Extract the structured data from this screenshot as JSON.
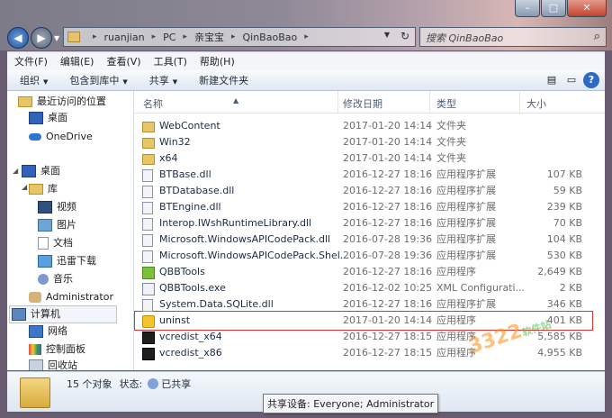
{
  "window": {
    "min": "–",
    "max": "□",
    "close": "✕"
  },
  "address": {
    "crumbs": [
      "ruanjian",
      "PC",
      "亲宝宝",
      "QinBaoBao"
    ]
  },
  "search": {
    "placeholder": "搜索 QinBaoBao"
  },
  "menu": [
    "文件(F)",
    "编辑(E)",
    "查看(V)",
    "工具(T)",
    "帮助(H)"
  ],
  "toolbar": {
    "organize": "组织",
    "include": "包含到库中",
    "share": "共享",
    "new_folder": "新建文件夹"
  },
  "sidebar": {
    "recent": "最近访问的位置",
    "desktop_fav": "桌面",
    "onedrive": "OneDrive",
    "desktop": "桌面",
    "libraries": "库",
    "videos": "视频",
    "pictures": "图片",
    "documents": "文档",
    "thunder": "迅雷下载",
    "music": "音乐",
    "admin": "Administrator",
    "computer": "计算机",
    "network": "网络",
    "control": "控制面板",
    "recycle": "回收站"
  },
  "columns": {
    "name": "名称",
    "date": "修改日期",
    "type": "类型",
    "size": "大小"
  },
  "files": [
    {
      "name": "WebContent",
      "date": "2017-01-20 14:14",
      "type": "文件夹",
      "size": "",
      "icon": "folder"
    },
    {
      "name": "Win32",
      "date": "2017-01-20 14:14",
      "type": "文件夹",
      "size": "",
      "icon": "folder"
    },
    {
      "name": "x64",
      "date": "2017-01-20 14:14",
      "type": "文件夹",
      "size": "",
      "icon": "folder"
    },
    {
      "name": "BTBase.dll",
      "date": "2016-12-27 18:16",
      "type": "应用程序扩展",
      "size": "107 KB",
      "icon": "dll"
    },
    {
      "name": "BTDatabase.dll",
      "date": "2016-12-27 18:16",
      "type": "应用程序扩展",
      "size": "59 KB",
      "icon": "dll"
    },
    {
      "name": "BTEngine.dll",
      "date": "2016-12-27 18:16",
      "type": "应用程序扩展",
      "size": "239 KB",
      "icon": "dll"
    },
    {
      "name": "Interop.IWshRuntimeLibrary.dll",
      "date": "2016-12-27 18:16",
      "type": "应用程序扩展",
      "size": "70 KB",
      "icon": "dll"
    },
    {
      "name": "Microsoft.WindowsAPICodePack.dll",
      "date": "2016-07-28 19:36",
      "type": "应用程序扩展",
      "size": "104 KB",
      "icon": "dll"
    },
    {
      "name": "Microsoft.WindowsAPICodePack.Shel...",
      "date": "2016-07-28 19:36",
      "type": "应用程序扩展",
      "size": "530 KB",
      "icon": "dll"
    },
    {
      "name": "QBBTools",
      "date": "2016-12-27 18:16",
      "type": "应用程序",
      "size": "2,649 KB",
      "icon": "qbb"
    },
    {
      "name": "QBBTools.exe",
      "date": "2016-12-02 10:25",
      "type": "XML Configurati...",
      "size": "2 KB",
      "icon": "exe"
    },
    {
      "name": "System.Data.SQLite.dll",
      "date": "2016-12-27 18:16",
      "type": "应用程序扩展",
      "size": "346 KB",
      "icon": "dll"
    },
    {
      "name": "uninst",
      "date": "2017-01-20 14:14",
      "type": "应用程序",
      "size": "401 KB",
      "icon": "uninst"
    },
    {
      "name": "vcredist_x64",
      "date": "2016-12-27 18:15",
      "type": "应用程序",
      "size": "5,585 KB",
      "icon": "vc"
    },
    {
      "name": "vcredist_x86",
      "date": "2016-12-27 18:15",
      "type": "应用程序",
      "size": "4,955 KB",
      "icon": "vc"
    }
  ],
  "watermark": {
    "digits": "3322",
    "cn": "软件站"
  },
  "status": {
    "count": "15 个对象",
    "state_label": "状态:",
    "state": "已共享"
  },
  "tooltip": "共享设备: Everyone; Administrator"
}
